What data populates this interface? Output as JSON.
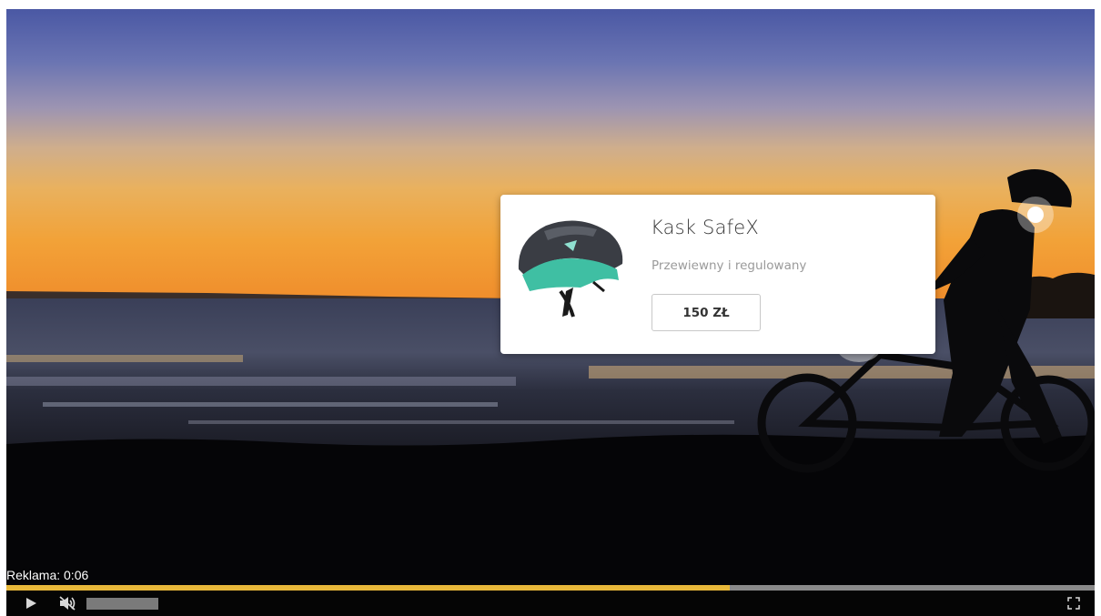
{
  "product": {
    "name": "Kask SafeX",
    "description": "Przewiewny i regulowany",
    "price": "150 ZŁ"
  },
  "player": {
    "ad_label": "Reklama: 0:06",
    "progress": 0.665,
    "volume": 1.0
  },
  "icons": {
    "play": "play-icon",
    "mute": "speaker-muted-icon",
    "fullscreen": "fullscreen-icon",
    "hotspot": "hotspot-dot-icon"
  },
  "colors": {
    "progress": "#e8b83a",
    "progress_track": "#8a8a8a",
    "controls_bg": "#050505",
    "sky_top": "#4a5aa6",
    "horizon": "#f2a238"
  }
}
